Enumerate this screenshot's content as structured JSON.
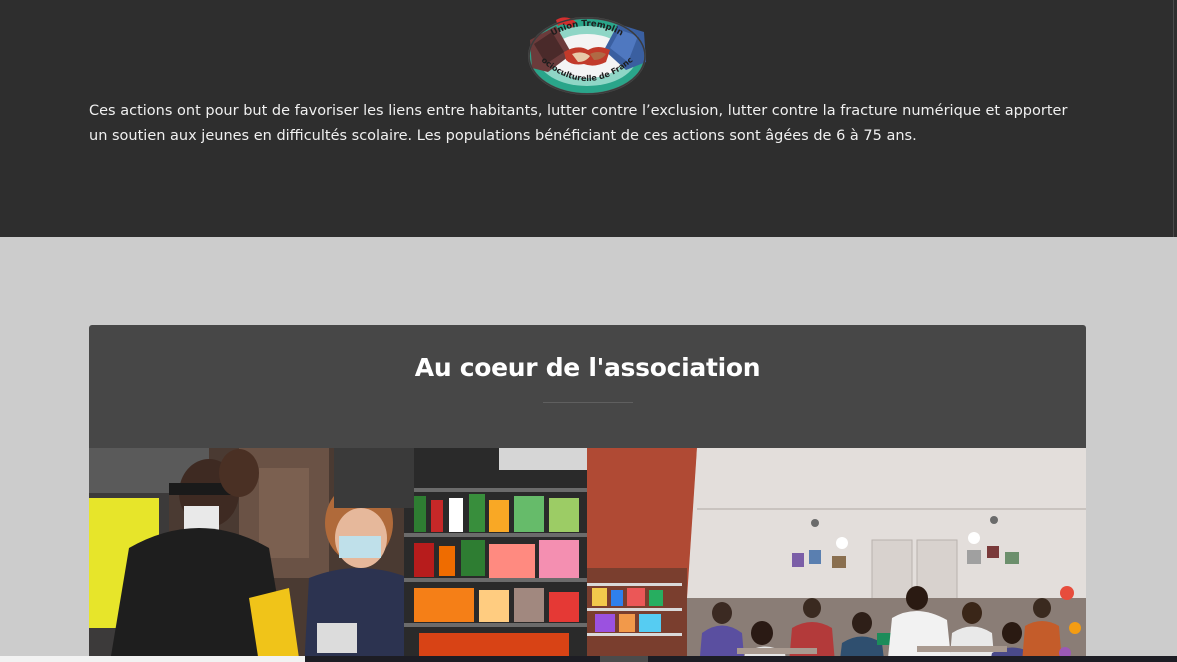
{
  "logo": {
    "top_text": "Union Tremplin",
    "bottom_text": "Socioculturelle de France"
  },
  "intro": {
    "text": "Ces actions ont pour but de favoriser les liens entre habitants, lutter contre l’exclusion, lutter contre la fracture numérique et apporter un soutien aux jeunes en difficultés scolaire. Les populations bénéficiant de ces actions sont âgées de 6 à 75 ans."
  },
  "section": {
    "title": "Au coeur de l'association"
  },
  "gallery": {
    "photos": [
      {
        "name": "food-distribution-photo"
      },
      {
        "name": "homework-help-photo"
      }
    ]
  },
  "colors": {
    "top_background": "#2e2e2e",
    "page_background": "#cccccc",
    "card_background": "#474747",
    "text": "#ffffff"
  }
}
